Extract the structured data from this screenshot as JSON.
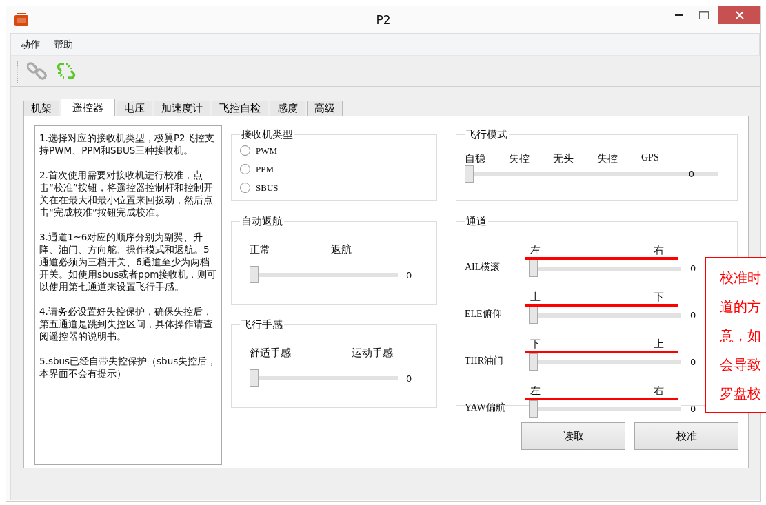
{
  "window": {
    "title": "P2"
  },
  "menu": [
    "动作",
    "帮助"
  ],
  "tabs": [
    {
      "label": "机架",
      "selected": false
    },
    {
      "label": "遥控器",
      "selected": true
    },
    {
      "label": "电压",
      "selected": false
    },
    {
      "label": "加速度计",
      "selected": false
    },
    {
      "label": "飞控自检",
      "selected": false
    },
    {
      "label": "感度",
      "selected": false
    },
    {
      "label": "高级",
      "selected": false
    }
  ],
  "help_text": [
    "1.选择对应的接收机类型，极翼P2飞控支持PWM、PPM和SBUS三种接收机。",
    "2.首次使用需要对接收机进行校准，点击“校准”按钮，将遥控器控制杆和控制开关在在最大和最小位置来回拨动，然后点击“完成校准”按钮完成校准。",
    "3.通道1~6对应的顺序分别为副翼、升降、油门、方向舵、操作模式和返航。5通道必须为三档开关、6通道至少为两档开关。如使用sbus或者ppm接收机，则可以使用第七通道来设置飞行手感。",
    "4.请务必设置好失控保护，确保失控后，第五通道是跳到失控区间，具体操作请查阅遥控器的说明书。",
    "5.sbus已经自带失控保护（sbus失控后，本界面不会有提示）"
  ],
  "receiver_type": {
    "title": "接收机类型",
    "options": [
      {
        "label": "PWM",
        "selected": false
      },
      {
        "label": "PPM",
        "selected": false
      },
      {
        "label": "SBUS",
        "selected": false
      }
    ]
  },
  "return_home": {
    "title": "自动返航",
    "labels": [
      "正常",
      "返航"
    ],
    "level": 0,
    "reading": "0"
  },
  "flight_feel": {
    "title": "飞行手感",
    "labels": [
      "舒适手感",
      "运动手感"
    ],
    "level": 0,
    "reading": "0"
  },
  "flight_mode": {
    "title": "飞行模式",
    "labels": [
      "自稳",
      "失控",
      "无头",
      "失控",
      "GPS"
    ],
    "level": 0,
    "reading": "0"
  },
  "channels": {
    "title": "通道",
    "items": [
      {
        "name": "AIL横滚",
        "left": "左",
        "right": "右",
        "level": 0,
        "reading": "0"
      },
      {
        "name": "ELE俯仰",
        "left": "上",
        "right": "下",
        "level": 0,
        "reading": "0"
      },
      {
        "name": "THR油门",
        "left": "下",
        "right": "上",
        "level": 0,
        "reading": "0"
      },
      {
        "name": "YAW偏航",
        "left": "左",
        "right": "右",
        "level": 0,
        "reading": "0"
      }
    ]
  },
  "buttons": [
    "读取",
    "校准"
  ],
  "callout": {
    "lines": [
      "校准时",
      "道的方",
      "意，如",
      "会导致",
      "罗盘校"
    ]
  }
}
